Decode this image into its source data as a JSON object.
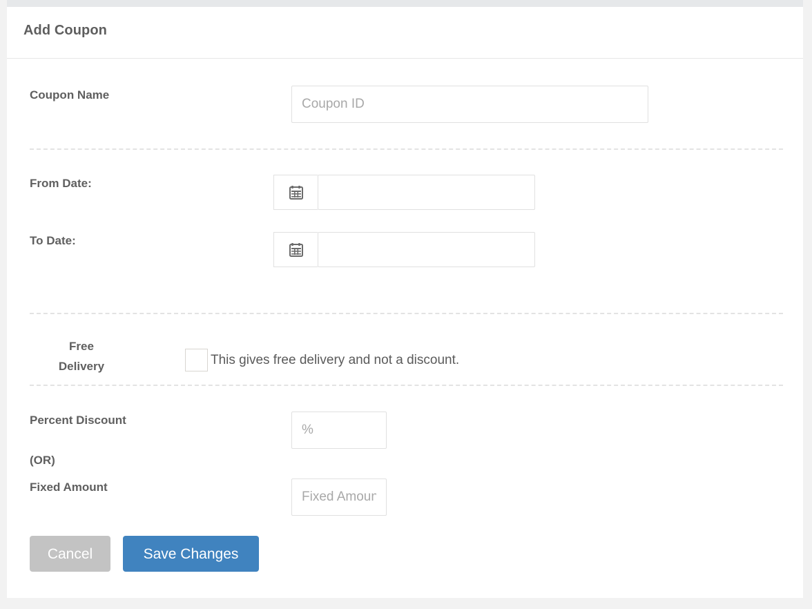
{
  "window": {
    "title": "Add Coupon"
  },
  "form": {
    "coupon_name": {
      "label": "Coupon Name",
      "placeholder": "Coupon ID",
      "value": ""
    },
    "from_date": {
      "label": "From Date:",
      "icon": "calendar-icon",
      "placeholder": "",
      "value": ""
    },
    "to_date": {
      "label": "To Date:",
      "icon": "calendar-icon",
      "placeholder": "",
      "value": ""
    },
    "free_delivery": {
      "label_line1": "Free",
      "label_line2": "Delivery",
      "checkbox_text": "This gives free delivery and not a discount.",
      "checked": false
    },
    "percent_discount": {
      "label": "Percent Discount",
      "placeholder": "%",
      "value": ""
    },
    "or_separator": "(OR)",
    "fixed_amount": {
      "label": "Fixed Amount",
      "placeholder": "Fixed Amount",
      "value": ""
    }
  },
  "actions": {
    "cancel_label": "Cancel",
    "save_label": "Save Changes"
  },
  "colors": {
    "page_background": "#f2f2f2",
    "panel_background": "#ffffff",
    "top_strip": "#e6e8ea",
    "label_text": "#5f5f5f",
    "placeholder_text": "#a8a8a8",
    "input_border": "#e0e0e0",
    "divider": "#e3e3e3",
    "cancel_button": "#c3c3c3",
    "primary_button": "#4083bf"
  }
}
